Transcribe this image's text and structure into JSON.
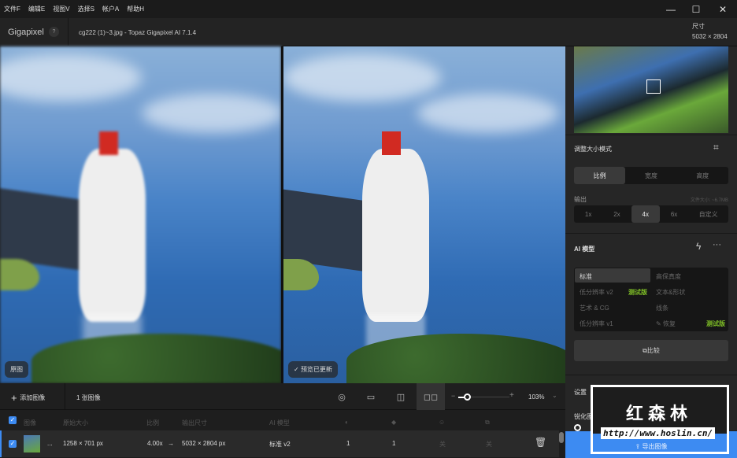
{
  "menu": [
    "文件F",
    "编辑E",
    "视图V",
    "选择S",
    "帐户A",
    "帮助H"
  ],
  "window": {
    "minimize": "—",
    "maximize": "☐",
    "close": "✕"
  },
  "title": {
    "app": "Gigapixel",
    "help": "?",
    "file": "cg222 (1)~3.jpg - Topaz Gigapixel AI 7.1.4",
    "size_label": "尺寸",
    "size_value": "5032 × 2804"
  },
  "preview": {
    "original_label": "原图",
    "updated_label": "预览已更新"
  },
  "resize": {
    "title": "调整大小模式",
    "modes": [
      "比例",
      "宽度",
      "高度"
    ],
    "active_mode": "比例",
    "output_label": "输出",
    "file_size": "文件大小: ~6.7MB",
    "scales": [
      "1x",
      "2x",
      "4x",
      "6x",
      "自定义"
    ],
    "active_scale": "4x"
  },
  "ai_model": {
    "title": "AI 模型",
    "more": "···",
    "models": [
      {
        "name": "标准",
        "active": true
      },
      {
        "name": "高保真度"
      },
      {
        "name": "低分辨率 v2",
        "badge": "测试版"
      },
      {
        "name": "文本&形状"
      },
      {
        "name": "艺术 & CG"
      },
      {
        "name": "线条"
      },
      {
        "name": "低分辨率 v1"
      },
      {
        "name": "恢复",
        "badge": "测试版"
      }
    ],
    "compare": "比较"
  },
  "settings": {
    "title": "设置",
    "sharpen_label": "锐化图像",
    "sharpen_value": "1",
    "export": "导出图像"
  },
  "watermark": {
    "name": "红森林",
    "url": "http://www.hoslin.cn/"
  },
  "toolbar": {
    "add": "添加图像",
    "count": "1 张图像",
    "zoom": "103%",
    "zoom_minus": "−",
    "zoom_plus": "+"
  },
  "table": {
    "headers": [
      "图像",
      "原始大小",
      "比例",
      "输出尺寸",
      "AI 模型"
    ],
    "row": {
      "name": "...",
      "orig": "1258 × 701 px",
      "scale": "4.00x",
      "arrow": "→",
      "out": "5032 × 2804 px",
      "model": "标准 v2",
      "c1": "1",
      "c2": "1",
      "c3": "关",
      "c4": "关"
    }
  },
  "colors": {
    "accent": "#3d8bf2",
    "beta": "#7fbf26"
  }
}
